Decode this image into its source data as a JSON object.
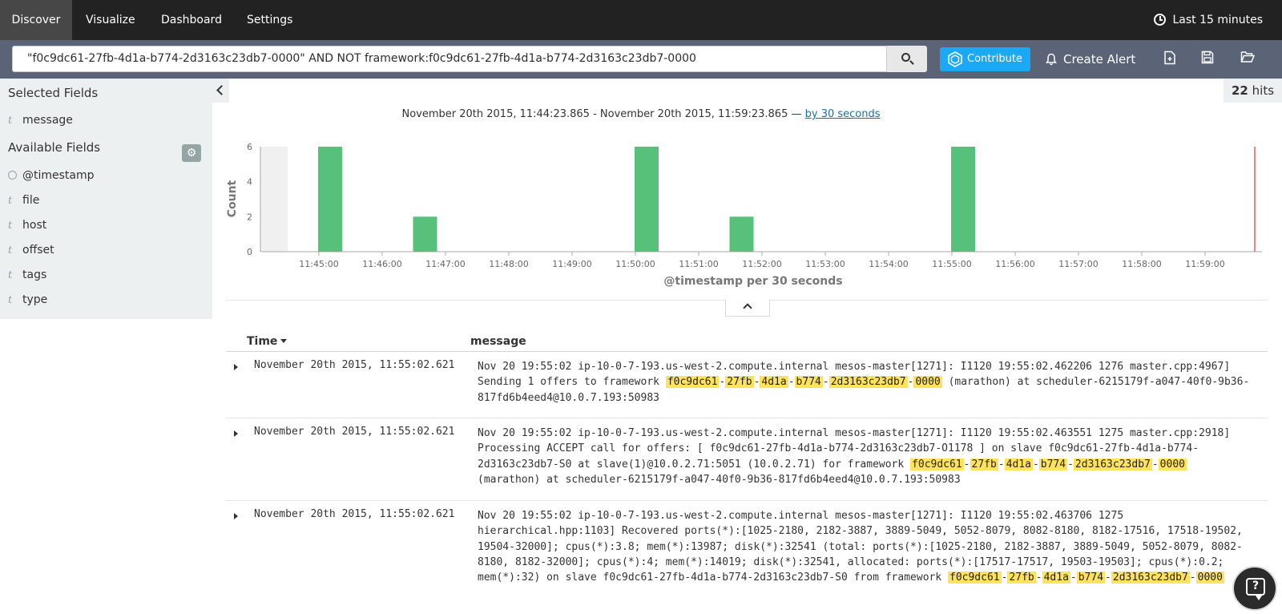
{
  "nav": {
    "tabs": [
      {
        "label": "Discover",
        "active": true
      },
      {
        "label": "Visualize",
        "active": false
      },
      {
        "label": "Dashboard",
        "active": false
      },
      {
        "label": "Settings",
        "active": false
      }
    ],
    "time_picker": {
      "label": "Last 15 minutes",
      "icon": "clock-icon"
    }
  },
  "search": {
    "query": "\"f0c9dc61-27fb-4d1a-b774-2d3163c23db7-0000\" AND NOT framework:f0c9dc61-27fb-4d1a-b774-2d3163c23db7-0000",
    "button_icon": "search-icon"
  },
  "toolbar": {
    "contribute_label": "Contribute",
    "create_alert_label": "Create Alert",
    "icons": [
      "new-document-icon",
      "save-icon",
      "open-folder-icon"
    ]
  },
  "sidebar": {
    "selected_title": "Selected Fields",
    "selected_fields": [
      {
        "type": "t",
        "name": "message"
      }
    ],
    "available_title": "Available Fields",
    "available_fields": [
      {
        "type": "clock",
        "name": "@timestamp"
      },
      {
        "type": "t",
        "name": "file"
      },
      {
        "type": "t",
        "name": "host"
      },
      {
        "type": "t",
        "name": "offset"
      },
      {
        "type": "t",
        "name": "tags"
      },
      {
        "type": "t",
        "name": "type"
      }
    ]
  },
  "hits": {
    "count": "22",
    "label": "hits"
  },
  "histogram": {
    "range_text": "November 20th 2015, 11:44:23.865 - November 20th 2015, 11:59:23.865 —",
    "interval_link": "by 30 seconds"
  },
  "chart_data": {
    "type": "bar",
    "xlabel": "@timestamp per 30 seconds",
    "ylabel": "Count",
    "ylim": [
      0,
      6
    ],
    "yticks": [
      0,
      2,
      4,
      6
    ],
    "x_ticks": [
      "11:45:00",
      "11:46:00",
      "11:47:00",
      "11:48:00",
      "11:49:00",
      "11:50:00",
      "11:51:00",
      "11:52:00",
      "11:53:00",
      "11:54:00",
      "11:55:00",
      "11:56:00",
      "11:57:00",
      "11:58:00",
      "11:59:00"
    ],
    "bars": [
      {
        "x": "11:45:00",
        "value": 6
      },
      {
        "x": "11:46:30",
        "value": 2
      },
      {
        "x": "11:50:00",
        "value": 6
      },
      {
        "x": "11:51:30",
        "value": 2
      },
      {
        "x": "11:55:00",
        "value": 6
      }
    ],
    "bar_color": "#57c17b",
    "grid": false
  },
  "table": {
    "columns": [
      "Time",
      "message"
    ],
    "rows": [
      {
        "time": "November 20th 2015, 11:55:02.621",
        "message": [
          {
            "t": "Nov 20 19:55:02 ip-10-0-7-193.us-west-2.compute.internal mesos-master[1271]: I1120 19:55:02.462206  1276 master.cpp:4967] Sending 1 offers to framework "
          },
          {
            "h": "f0c9dc61"
          },
          {
            "t": "-"
          },
          {
            "h": "27fb"
          },
          {
            "t": "-"
          },
          {
            "h": "4d1a"
          },
          {
            "t": "-"
          },
          {
            "h": "b774"
          },
          {
            "t": "-"
          },
          {
            "h": "2d3163c23db7"
          },
          {
            "t": "-"
          },
          {
            "h": "0000"
          },
          {
            "t": " (marathon) at scheduler-6215179f-a047-40f0-9b36-817fd6b4eed4@10.0.7.193:50983"
          }
        ]
      },
      {
        "time": "November 20th 2015, 11:55:02.621",
        "message": [
          {
            "t": "Nov 20 19:55:02 ip-10-0-7-193.us-west-2.compute.internal mesos-master[1271]: I1120 19:55:02.463551  1275 master.cpp:2918] Processing ACCEPT call for offers: [ f0c9dc61-27fb-4d1a-b774-2d3163c23db7-O1178 ] on slave f0c9dc61-27fb-4d1a-b774-2d3163c23db7-S0 at slave(1)@10.0.2.71:5051 (10.0.2.71) for framework "
          },
          {
            "h": "f0c9dc61"
          },
          {
            "t": "-"
          },
          {
            "h": "27fb"
          },
          {
            "t": "-"
          },
          {
            "h": "4d1a"
          },
          {
            "t": "-"
          },
          {
            "h": "b774"
          },
          {
            "t": "-"
          },
          {
            "h": "2d3163c23db7"
          },
          {
            "t": "-"
          },
          {
            "h": "0000"
          },
          {
            "t": " (marathon) at scheduler-6215179f-a047-40f0-9b36-817fd6b4eed4@10.0.7.193:50983"
          }
        ]
      },
      {
        "time": "November 20th 2015, 11:55:02.621",
        "message": [
          {
            "t": "Nov 20 19:55:02 ip-10-0-7-193.us-west-2.compute.internal mesos-master[1271]: I1120 19:55:02.463706  1275 hierarchical.hpp:1103] Recovered ports(*):[1025-2180, 2182-3887, 3889-5049, 5052-8079, 8082-8180, 8182-17516, 17518-19502, 19504-32000]; cpus(*):3.8; mem(*):13987; disk(*):32541 (total: ports(*):[1025-2180, 2182-3887, 3889-5049, 5052-8079, 8082-8180, 8182-32000]; cpus(*):4; mem(*):14019; disk(*):32541, allocated: ports(*):[17517-17517, 19503-19503]; cpus(*):0.2; mem(*):32) on slave f0c9dc61-27fb-4d1a-b774-2d3163c23db7-S0 from framework "
          },
          {
            "h": "f0c9dc61"
          },
          {
            "t": "-"
          },
          {
            "h": "27fb"
          },
          {
            "t": "-"
          },
          {
            "h": "4d1a"
          },
          {
            "t": "-"
          },
          {
            "h": "b774"
          },
          {
            "t": "-"
          },
          {
            "h": "2d3163c23db7"
          },
          {
            "t": "-"
          },
          {
            "h": "0000"
          }
        ]
      }
    ]
  },
  "help_icon": "help-chat-icon"
}
